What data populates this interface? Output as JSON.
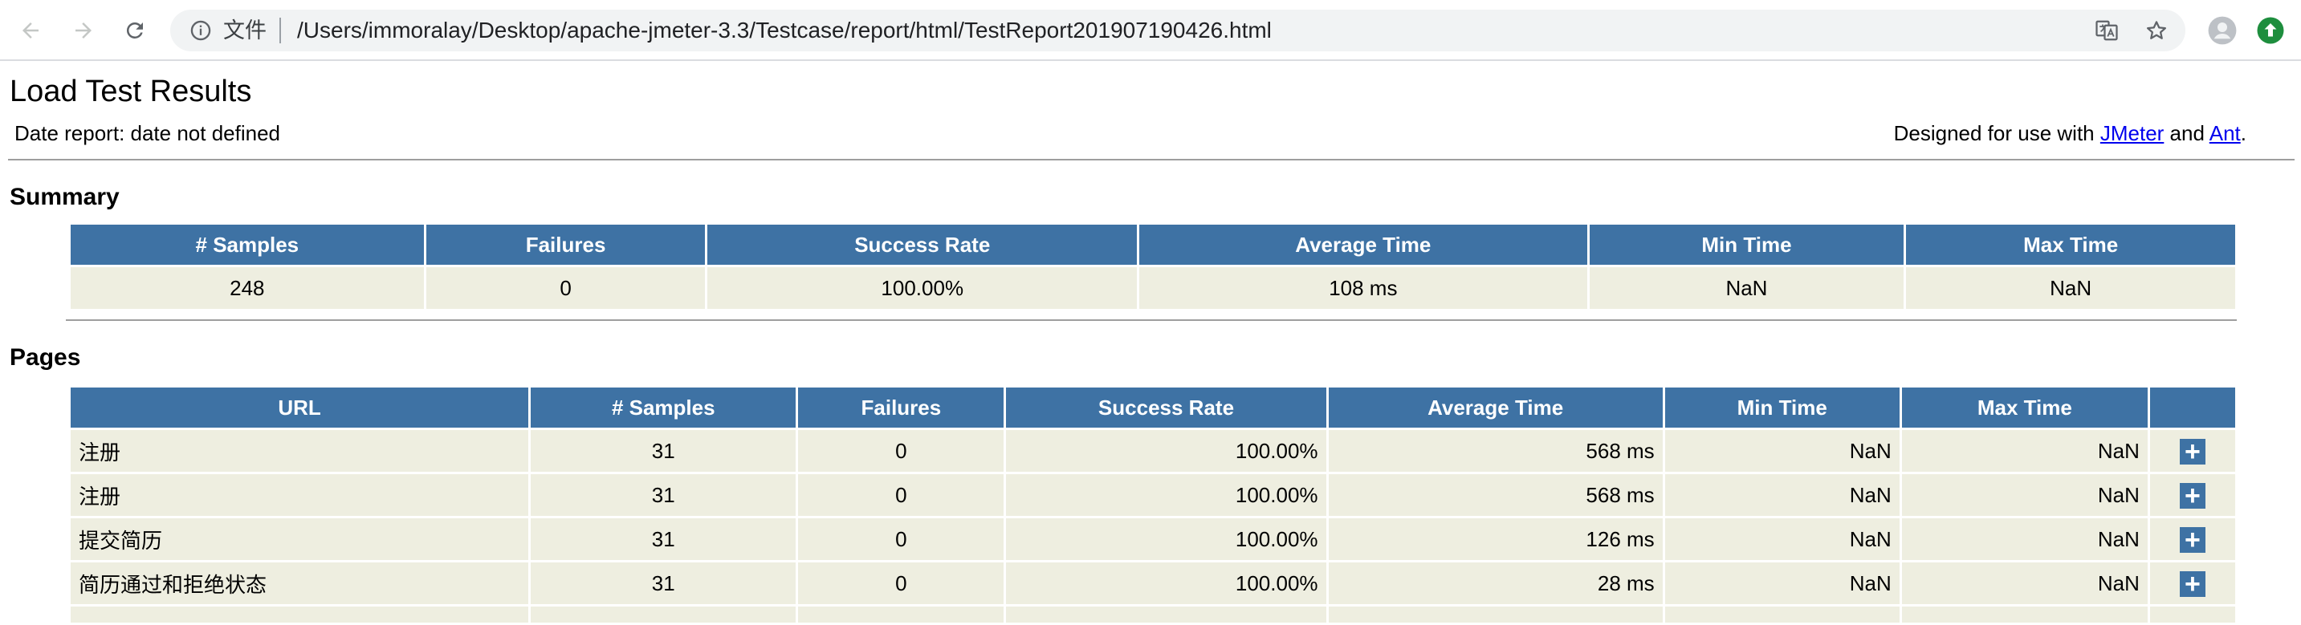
{
  "browser": {
    "omnibox_label": "文件",
    "url": "/Users/immoralay/Desktop/apache-jmeter-3.3/Testcase/report/html/TestReport201907190426.html"
  },
  "report": {
    "title": "Load Test Results",
    "date_line": "Date report: date not defined",
    "designed_prefix": "Designed for use with ",
    "jmeter_link": "JMeter",
    "and_text": " and ",
    "ant_link": "Ant",
    "period": "."
  },
  "summary": {
    "heading": "Summary",
    "headers": [
      "# Samples",
      "Failures",
      "Success Rate",
      "Average Time",
      "Min Time",
      "Max Time"
    ],
    "row": [
      "248",
      "0",
      "100.00%",
      "108 ms",
      "NaN",
      "NaN"
    ]
  },
  "pages": {
    "heading": "Pages",
    "headers": [
      "URL",
      "# Samples",
      "Failures",
      "Success Rate",
      "Average Time",
      "Min Time",
      "Max Time",
      ""
    ],
    "rows": [
      {
        "url": "注册",
        "samples": "31",
        "failures": "0",
        "success": "100.00%",
        "avg": "568 ms",
        "min": "NaN",
        "max": "NaN",
        "expand": "+"
      },
      {
        "url": "注册",
        "samples": "31",
        "failures": "0",
        "success": "100.00%",
        "avg": "568 ms",
        "min": "NaN",
        "max": "NaN",
        "expand": "+"
      },
      {
        "url": "提交简历",
        "samples": "31",
        "failures": "0",
        "success": "100.00%",
        "avg": "126 ms",
        "min": "NaN",
        "max": "NaN",
        "expand": "+"
      },
      {
        "url": "简历通过和拒绝状态",
        "samples": "31",
        "failures": "0",
        "success": "100.00%",
        "avg": "28 ms",
        "min": "NaN",
        "max": "NaN",
        "expand": "+"
      }
    ]
  },
  "colors": {
    "header_bg": "#3e72a4",
    "cell_bg": "#eeeee0",
    "link": "#0000ee"
  },
  "icons": [
    "back-arrow-icon",
    "forward-arrow-icon",
    "reload-icon",
    "info-icon",
    "translate-icon",
    "star-icon",
    "avatar-icon",
    "update-icon",
    "plus-icon"
  ]
}
